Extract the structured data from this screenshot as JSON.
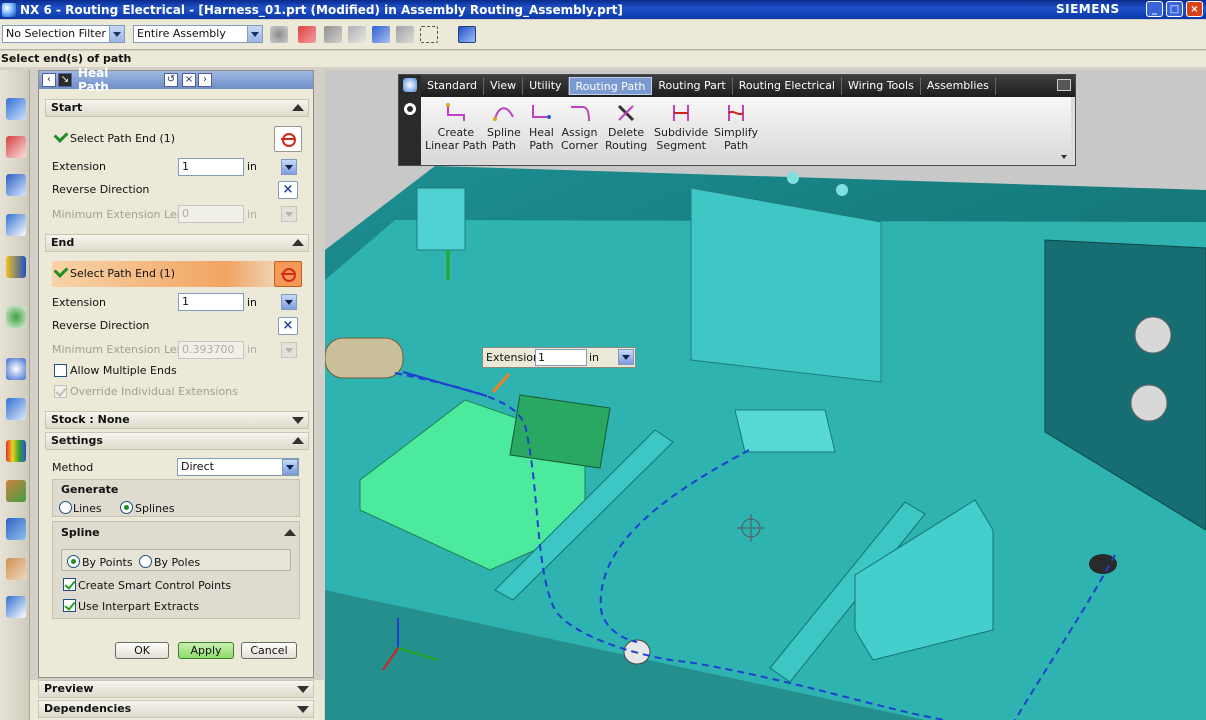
{
  "window": {
    "title": "NX 6 - Routing Electrical - [Harness_01.prt (Modified)  in Assembly Routing_Assembly.prt]",
    "brand": "SIEMENS",
    "controls": [
      "_",
      "□",
      "×"
    ]
  },
  "toolbar": {
    "selection_filter": "No Selection Filter",
    "scope": "Entire Assembly"
  },
  "cue_line": "Select end(s) of path",
  "dialog": {
    "title": "Heal Path",
    "start": {
      "header": "Start",
      "select_label": "Select Path End (1)",
      "extension_label": "Extension",
      "extension_value": "1",
      "extension_unit": "in",
      "reverse_label": "Reverse Direction",
      "min_ext_label": "Minimum Extension Length",
      "min_ext_value": "0",
      "min_ext_unit": "in"
    },
    "end": {
      "header": "End",
      "select_label": "Select Path End (1)",
      "extension_label": "Extension",
      "extension_value": "1",
      "extension_unit": "in",
      "reverse_label": "Reverse Direction",
      "min_ext_label": "Minimum Extension Length",
      "min_ext_value": "0.393700",
      "min_ext_unit": "in",
      "allow_multiple_label": "Allow Multiple Ends",
      "allow_multiple_checked": false,
      "override_label": "Override Individual Extensions",
      "override_checked": true
    },
    "stock_header": "Stock : None",
    "settings": {
      "header": "Settings",
      "method_label": "Method",
      "method_value": "Direct",
      "generate_title": "Generate",
      "generate_options": [
        "Lines",
        "Splines"
      ],
      "generate_selected": "Splines",
      "spline_title": "Spline",
      "spline_options": [
        "By Points",
        "By Poles"
      ],
      "spline_selected": "By Points",
      "smart_points_label": "Create Smart Control Points",
      "smart_points_checked": true,
      "interpart_label": "Use Interpart Extracts",
      "interpart_checked": true
    },
    "buttons": {
      "ok": "OK",
      "apply": "Apply",
      "cancel": "Cancel"
    }
  },
  "panels_below": [
    "Preview",
    "Dependencies"
  ],
  "ribbon": {
    "tabs": [
      "Standard",
      "View",
      "Utility",
      "Routing Path",
      "Routing Part",
      "Routing Electrical",
      "Wiring Tools",
      "Assemblies"
    ],
    "active_tab": "Routing Path",
    "commands": [
      {
        "line1": "Create",
        "line2": "Linear Path",
        "icon": "linear-path-icon"
      },
      {
        "line1": "Spline",
        "line2": "Path",
        "icon": "spline-path-icon"
      },
      {
        "line1": "Heal",
        "line2": "Path",
        "icon": "heal-path-icon"
      },
      {
        "line1": "Assign",
        "line2": "Corner",
        "icon": "assign-corner-icon"
      },
      {
        "line1": "Delete",
        "line2": "Routing",
        "icon": "delete-routing-icon"
      },
      {
        "line1": "Subdivide",
        "line2": "Segment",
        "icon": "subdivide-segment-icon"
      },
      {
        "line1": "Simplify",
        "line2": "Path",
        "icon": "simplify-path-icon"
      }
    ]
  },
  "floating_extension": {
    "label": "Extension",
    "value": "1",
    "unit": "in"
  },
  "colors": {
    "titlebar": "#1e50c8",
    "model_surface": "#2fb3b0",
    "route_line": "#1f3fd0",
    "active_selection": "#f2a462"
  }
}
